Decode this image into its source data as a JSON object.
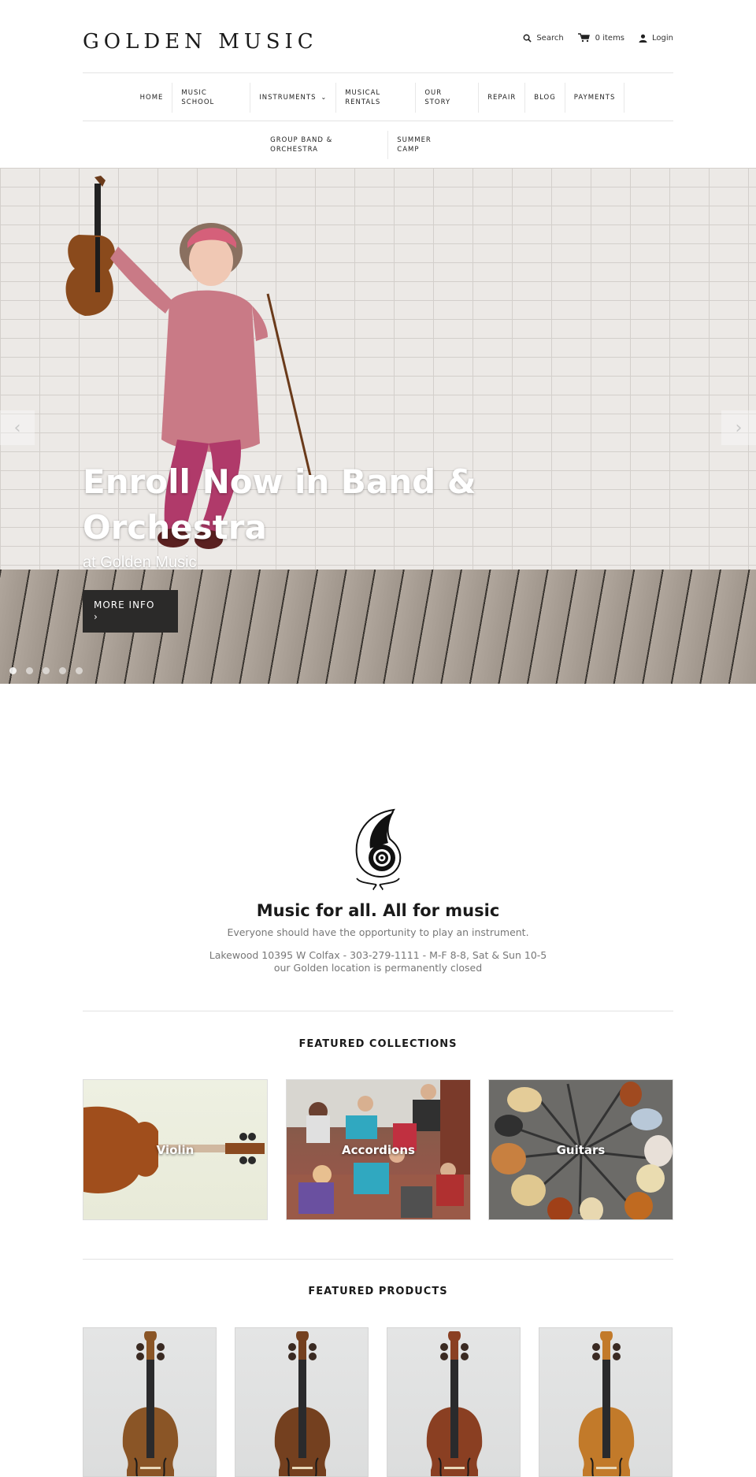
{
  "header": {
    "logo": "GOLDEN MUSIC",
    "utility": {
      "search_label": "Search",
      "search_icon": "search-icon",
      "cart_label": "0 items",
      "cart_icon": "cart-icon",
      "login_label": "Login",
      "login_icon": "user-icon"
    }
  },
  "nav": {
    "row1": [
      {
        "label": "HOME"
      },
      {
        "label": "MUSIC\nSCHOOL"
      },
      {
        "label": "INSTRUMENTS",
        "has_dropdown": true
      },
      {
        "label": "MUSICAL\nRENTALS"
      },
      {
        "label": "OUR\nSTORY"
      },
      {
        "label": "REPAIR"
      },
      {
        "label": "BLOG"
      },
      {
        "label": "PAYMENTS"
      }
    ],
    "row2": [
      {
        "label": "GROUP BAND &\nORCHESTRA"
      },
      {
        "label": "SUMMER\nCAMP"
      }
    ]
  },
  "hero": {
    "title": "Enroll Now in Band & Orchestra",
    "subtitle": "at Golden Music",
    "button_label": "MORE INFO",
    "button_icon": "›",
    "prev_icon": "‹",
    "next_icon": "›",
    "slide_count": 5,
    "active_slide": 1
  },
  "intro": {
    "title": "Music for all. All for music",
    "tagline": "Everyone should have the opportunity to play an instrument.",
    "address_line": "Lakewood 10395 W Colfax - 303-279-1111 - M-F 8-8, Sat & Sun 10-5",
    "closure_note": "our Golden location is permanently closed"
  },
  "featured_collections": {
    "title": "FEATURED COLLECTIONS",
    "items": [
      {
        "label": "Violin"
      },
      {
        "label": "Accordions"
      },
      {
        "label": "Guitars"
      }
    ]
  },
  "featured_products": {
    "title": "FEATURED PRODUCTS",
    "items": [
      {
        "finish": "#8a5526"
      },
      {
        "finish": "#74401f"
      },
      {
        "finish": "#8a3f22"
      },
      {
        "finish": "#c27a2a"
      }
    ]
  }
}
